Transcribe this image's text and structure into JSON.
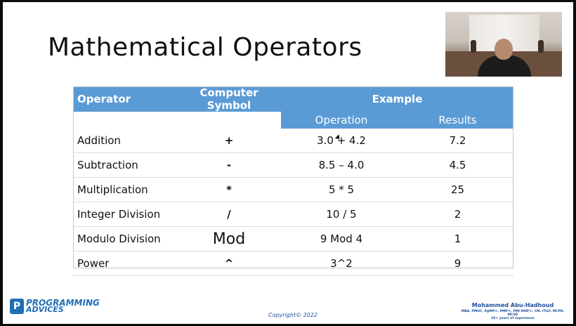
{
  "slide": {
    "title": "Mathematical Operators",
    "footer": {
      "logo_line1": "PROGRAMMING",
      "logo_line2": "ADVICES",
      "copyright": "Copyright© 2022",
      "author_name": "Mohammed Abu-Hadhoud",
      "author_credentials": "MBA, PMOC, PgMP®, PMP®, PMI-RMP®, CM, ITILF, MCPD, MCSD",
      "author_experience": "26+ years of experience"
    }
  },
  "table": {
    "headers": {
      "operator": "Operator",
      "symbol": "Computer Symbol",
      "example": "Example",
      "operation": "Operation",
      "results": "Results"
    },
    "rows": [
      {
        "operator": "Addition",
        "symbol": "+",
        "operation": "3.0 + 4.2",
        "result": "7.2"
      },
      {
        "operator": "Subtraction",
        "symbol": "-",
        "operation": "8.5 – 4.0",
        "result": "4.5"
      },
      {
        "operator": "Multiplication",
        "symbol": "*",
        "operation": "5 * 5",
        "result": "25"
      },
      {
        "operator": "Integer Division",
        "symbol": "/",
        "operation": "10 / 5",
        "result": "2"
      },
      {
        "operator": "Modulo Division",
        "symbol": "Mod",
        "operation": "9 Mod 4",
        "result": "1"
      },
      {
        "operator": "Power",
        "symbol": "^",
        "operation": "3^2",
        "result": "9"
      }
    ]
  },
  "colors": {
    "header_blue": "#5b9bd5",
    "footer_blue": "#1f4e9c"
  }
}
